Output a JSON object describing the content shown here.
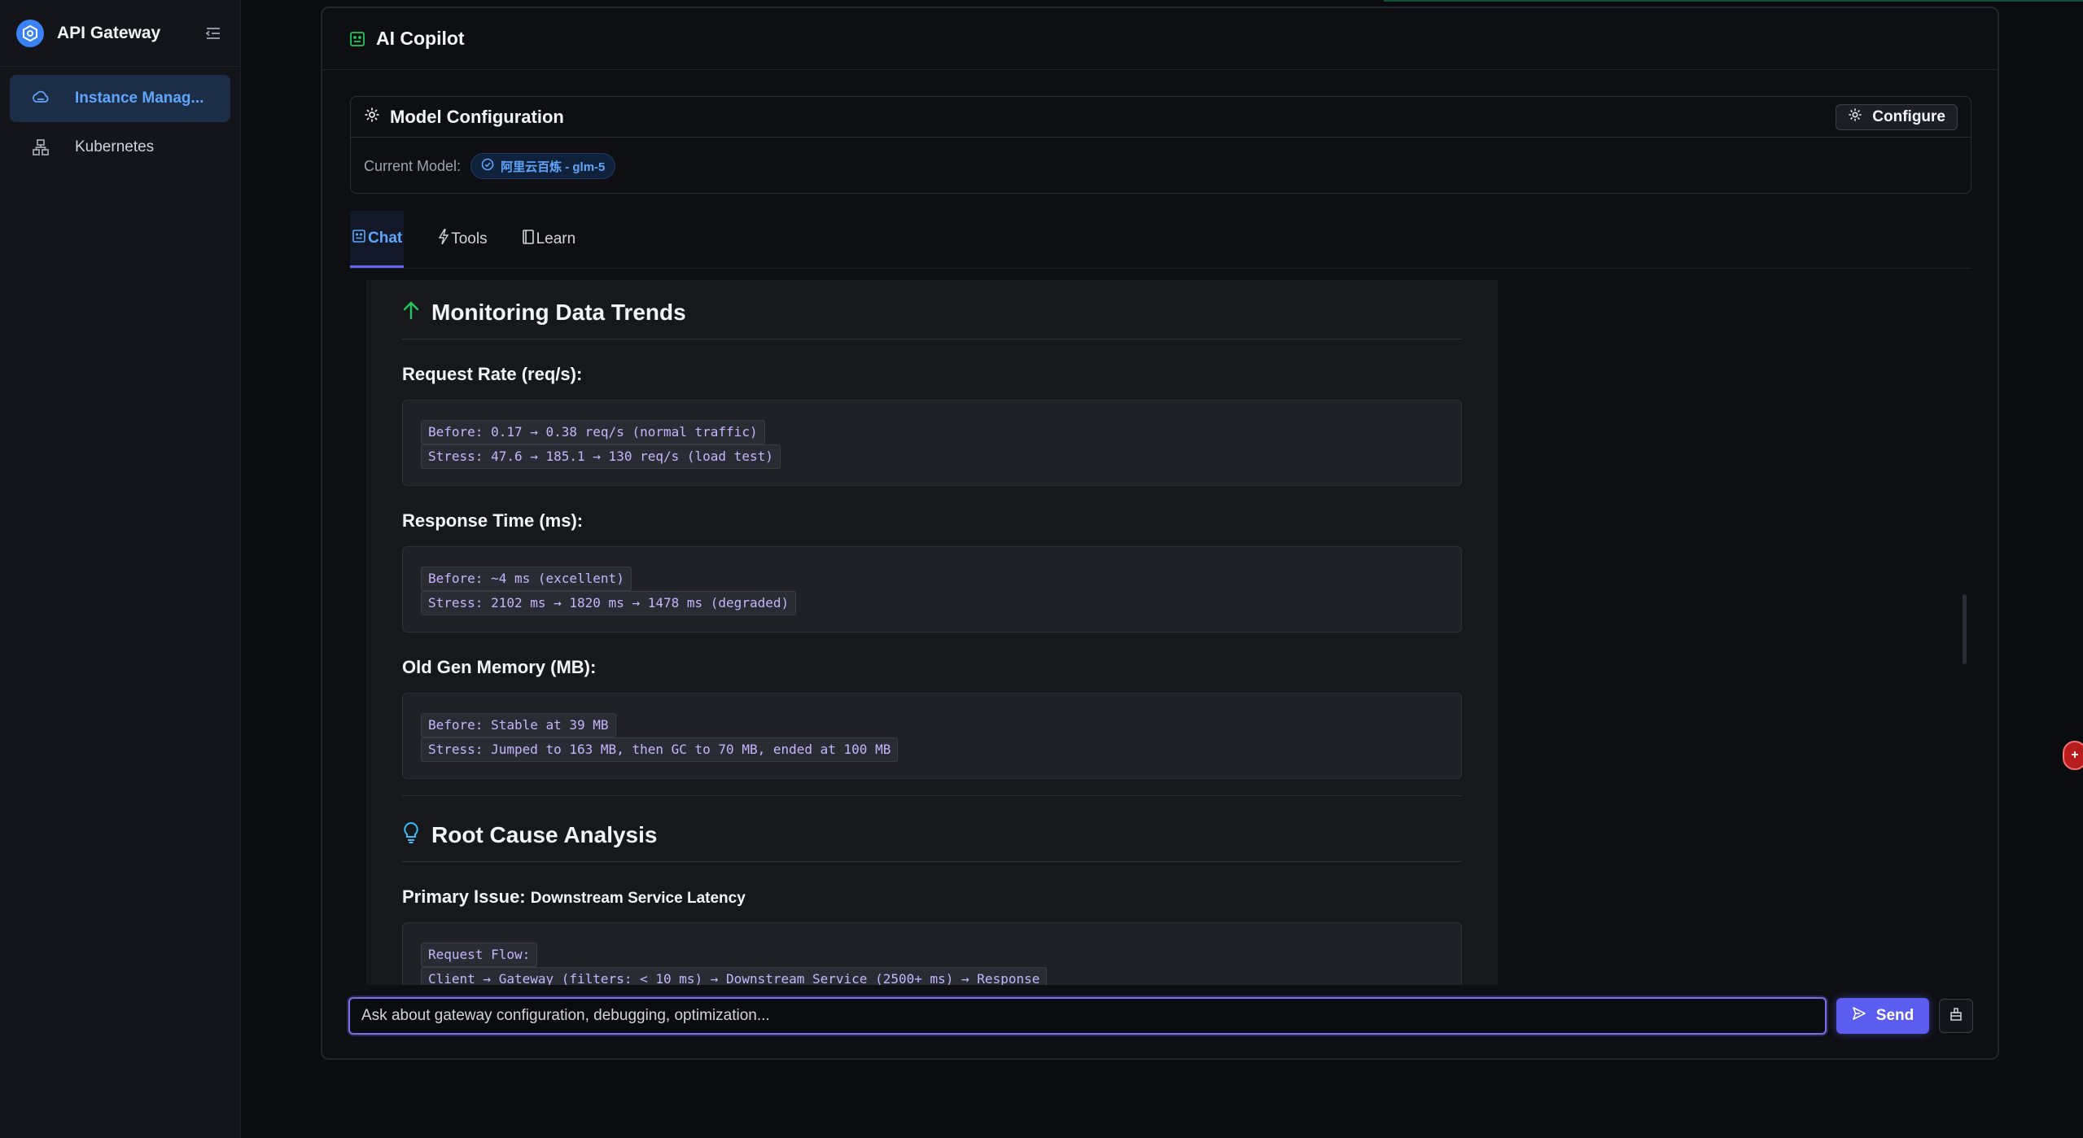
{
  "app": {
    "title": "API Gateway"
  },
  "sidebar": {
    "items": [
      {
        "label": "Instance Manag...",
        "icon": "instance-icon",
        "active": true
      },
      {
        "label": "Kubernetes",
        "icon": "kubernetes-icon",
        "active": false
      }
    ]
  },
  "panel": {
    "title": "AI Copilot"
  },
  "model_config": {
    "title": "Model Configuration",
    "configure_label": "Configure",
    "current_model_label": "Current Model:",
    "current_model_value": "阿里云百炼 - glm-5"
  },
  "tabs": [
    {
      "label": "Chat",
      "icon": "chat-icon",
      "active": true
    },
    {
      "label": "Tools",
      "icon": "lightning-icon",
      "active": false
    },
    {
      "label": "Learn",
      "icon": "book-icon",
      "active": false
    }
  ],
  "message": {
    "section1": {
      "heading": "Monitoring Data Trends",
      "blocks": [
        {
          "title": "Request Rate (req/s):",
          "lines": [
            "Before: 0.17 → 0.38 req/s (normal traffic)",
            "Stress: 47.6 → 185.1 → 130 req/s (load test)"
          ]
        },
        {
          "title": "Response Time (ms):",
          "lines": [
            "Before: ~4 ms (excellent)",
            "Stress: 2102 ms → 1820 ms → 1478 ms (degraded)"
          ]
        },
        {
          "title": "Old Gen Memory (MB):",
          "lines": [
            "Before: Stable at 39 MB",
            "Stress: Jumped to 163 MB, then GC to 70 MB, ended at 100 MB"
          ]
        }
      ]
    },
    "section2": {
      "heading": "Root Cause Analysis",
      "primary_label": "Primary Issue:",
      "primary_value": "Downstream Service Latency",
      "flow_lines": [
        "Request Flow:",
        "Client → Gateway (filters: < 10 ms) → Downstream Service (2500+ ms) → Response",
        "↑"
      ]
    }
  },
  "input": {
    "placeholder": "Ask about gateway configuration, debugging, optimization...",
    "send_label": "Send"
  },
  "colors": {
    "accent": "#5b5cf0",
    "link": "#60a5fa",
    "success": "#22c55e",
    "info": "#38bdf8"
  }
}
